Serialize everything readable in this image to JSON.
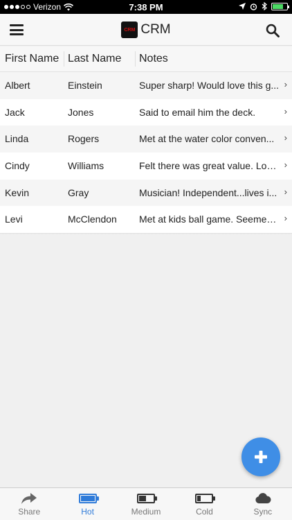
{
  "status_bar": {
    "carrier": "Verizon",
    "time": "7:38 PM",
    "battery_level": 0.75
  },
  "header": {
    "logo_text": "CRM",
    "title": "CRM"
  },
  "table": {
    "columns": [
      "First Name",
      "Last Name",
      "Notes"
    ],
    "rows": [
      {
        "first": "Albert",
        "last": "Einstein",
        "notes": "Super sharp! Would love this g..."
      },
      {
        "first": "Jack",
        "last": "Jones",
        "notes": "Said to email him the deck."
      },
      {
        "first": "Linda",
        "last": "Rogers",
        "notes": "Met at the water color conven..."
      },
      {
        "first": "Cindy",
        "last": "Williams",
        "notes": "Felt there was great value. Loo..."
      },
      {
        "first": "Kevin",
        "last": "Gray",
        "notes": "Musician! Independent...lives i..."
      },
      {
        "first": "Levi",
        "last": "McClendon",
        "notes": "Met at kids ball game. Seemed ..."
      }
    ]
  },
  "fab": {
    "icon": "plus-icon",
    "color": "#3f8ee6"
  },
  "tabs": [
    {
      "label": "Share",
      "icon": "share-icon"
    },
    {
      "label": "Hot",
      "icon": "battery-full-icon",
      "level": 1.0,
      "active": true
    },
    {
      "label": "Medium",
      "icon": "battery-half-icon",
      "level": 0.5
    },
    {
      "label": "Cold",
      "icon": "battery-low-icon",
      "level": 0.25
    },
    {
      "label": "Sync",
      "icon": "cloud-icon"
    }
  ],
  "colors": {
    "accent": "#2f7bd9",
    "logo_red": "#d01010"
  }
}
